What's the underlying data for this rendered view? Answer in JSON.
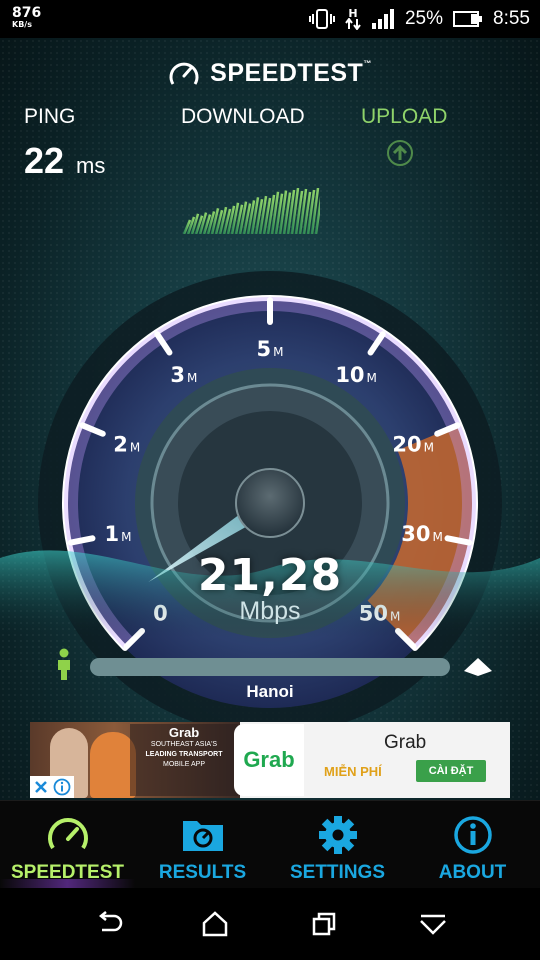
{
  "status_bar": {
    "net_speed_value": "876",
    "net_speed_unit": "KB/s",
    "network_type": "H",
    "battery_percent": "25%",
    "time": "8:55"
  },
  "header": {
    "logo_text": "SPEEDTEST",
    "trademark": "™"
  },
  "metrics": {
    "ping_label": "PING",
    "ping_value": "22",
    "ping_unit": "ms",
    "download_label": "DOWNLOAD",
    "upload_label": "UPLOAD"
  },
  "gauge": {
    "tick_labels": [
      {
        "num": "0",
        "unit": ""
      },
      {
        "num": "1",
        "unit": "M"
      },
      {
        "num": "2",
        "unit": "M"
      },
      {
        "num": "3",
        "unit": "M"
      },
      {
        "num": "5",
        "unit": "M"
      },
      {
        "num": "10",
        "unit": "M"
      },
      {
        "num": "20",
        "unit": "M"
      },
      {
        "num": "30",
        "unit": "M"
      },
      {
        "num": "50",
        "unit": "M"
      }
    ],
    "speed_value": "21,28",
    "speed_unit": "Mbps"
  },
  "server": {
    "location": "Hanoi"
  },
  "ad": {
    "brand": "Grab",
    "tagline_1": "SOUTHEAST ASIA'S",
    "tagline_2": "LEADING TRANSPORT",
    "tagline_3": "MOBILE APP",
    "logo_text": "Grab",
    "title": "Grab",
    "price": "MIỄN PHÍ",
    "install_label": "CÀI ĐẶT"
  },
  "tabs": [
    {
      "label": "SPEEDTEST",
      "icon": "speedometer-icon",
      "active": true
    },
    {
      "label": "RESULTS",
      "icon": "folder-icon",
      "active": false
    },
    {
      "label": "SETTINGS",
      "icon": "gear-icon",
      "active": false
    },
    {
      "label": "ABOUT",
      "icon": "info-icon",
      "active": false
    }
  ],
  "colors": {
    "accent_upload": "#8fd36a",
    "tab_label": "#1aa7e0",
    "tab_active": "#b6f06a",
    "gauge_orange": "#e07a32"
  }
}
